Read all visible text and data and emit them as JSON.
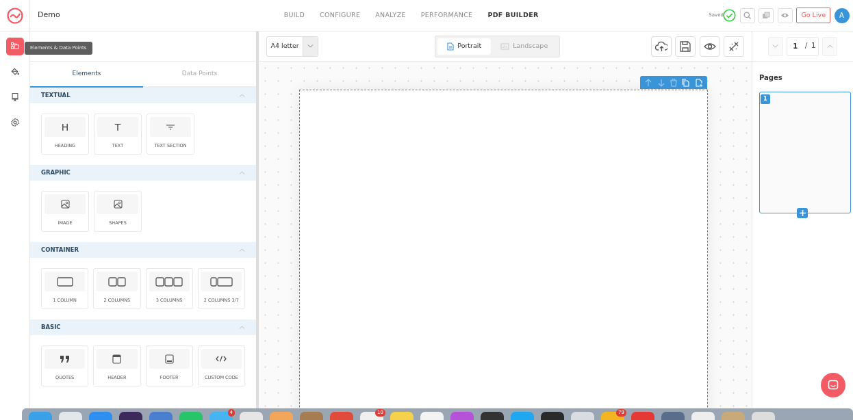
{
  "header": {
    "app_name": "Demo",
    "nav": [
      {
        "label": "BUILD",
        "selected": false
      },
      {
        "label": "CONFIGURE",
        "selected": false
      },
      {
        "label": "ANALYZE",
        "selected": false
      },
      {
        "label": "PERFORMANCE",
        "selected": false
      },
      {
        "label": "PDF BUILDER",
        "selected": true
      }
    ],
    "saved_label": "Saved",
    "go_live": "Go Live",
    "avatar": "A"
  },
  "rail": [
    {
      "kind": "elements",
      "selected": true
    },
    {
      "kind": "paint",
      "selected": false
    },
    {
      "kind": "brush",
      "selected": false
    },
    {
      "kind": "settings",
      "selected": false
    }
  ],
  "tooltip": "Elements & Data Points",
  "panel_tabs": [
    {
      "label": "Elements",
      "selected": true
    },
    {
      "label": "Data Points",
      "selected": false
    }
  ],
  "sections": [
    {
      "title": "TEXTUAL",
      "expanded": true,
      "items": [
        {
          "kind": "glyph",
          "glyph": "H",
          "label": "HEADING"
        },
        {
          "kind": "glyph",
          "glyph": "T",
          "label": "TEXT"
        },
        {
          "kind": "text-section",
          "label": "TEXT SECTION"
        }
      ]
    },
    {
      "title": "GRAPHIC",
      "expanded": true,
      "items": [
        {
          "kind": "image",
          "label": "IMAGE"
        },
        {
          "kind": "image",
          "label": "SHAPES"
        }
      ]
    },
    {
      "title": "CONTAINER",
      "expanded": true,
      "items": [
        {
          "kind": "col1",
          "label": "1 COLUMN"
        },
        {
          "kind": "col2",
          "label": "2 COLUMNS"
        },
        {
          "kind": "col3",
          "label": "3 COLUMNS"
        },
        {
          "kind": "col37",
          "label": "2 COLUMNS 3/7"
        }
      ]
    },
    {
      "title": "BASIC",
      "expanded": true,
      "items": [
        {
          "kind": "quotes",
          "label": "QUOTES"
        },
        {
          "kind": "header",
          "label": "HEADER"
        },
        {
          "kind": "footer",
          "label": "FOOTER"
        },
        {
          "kind": "code",
          "label": "CUSTOM CODE"
        }
      ]
    }
  ],
  "toolbar": {
    "page_size": "A4 letter",
    "orientations": [
      {
        "label": "Portrait",
        "selected": true
      },
      {
        "label": "Landscape",
        "selected": false
      }
    ]
  },
  "pager": {
    "current": "1",
    "separator": "/",
    "total": "1"
  },
  "pages_panel": {
    "title": "Pages",
    "pages": [
      {
        "number": "1",
        "selected": true
      }
    ]
  },
  "dock": [
    {
      "color": "#3aa0e8"
    },
    {
      "color": "#e4e7ea"
    },
    {
      "color": "#2f8ff0"
    },
    {
      "color": "#3b2a5a"
    },
    {
      "color": "#4a7fd0"
    },
    {
      "color": "#27c46a"
    },
    {
      "color": "#46b4f0",
      "badge": "4"
    },
    {
      "color": "#e6e6e6"
    },
    {
      "color": "#f2a65a"
    },
    {
      "color": "#a67c52"
    },
    {
      "color": "#e04b3c"
    },
    {
      "color": "#f0f0f0",
      "badge": "10"
    },
    {
      "color": "#f5d24a"
    },
    {
      "color": "#f3f3f3"
    },
    {
      "color": "#b552d8"
    },
    {
      "color": "#333333"
    },
    {
      "color": "#1fa7ef"
    },
    {
      "color": "#2a2a2a"
    },
    {
      "color": "#d9dde2"
    },
    {
      "color": "#f3b523",
      "badge": "79"
    },
    {
      "color": "#e53935"
    },
    {
      "color": "#5a6d8a"
    },
    {
      "color": "#eeeeee"
    },
    {
      "color": "#c8a979"
    },
    {
      "color": "#dddddd"
    }
  ]
}
